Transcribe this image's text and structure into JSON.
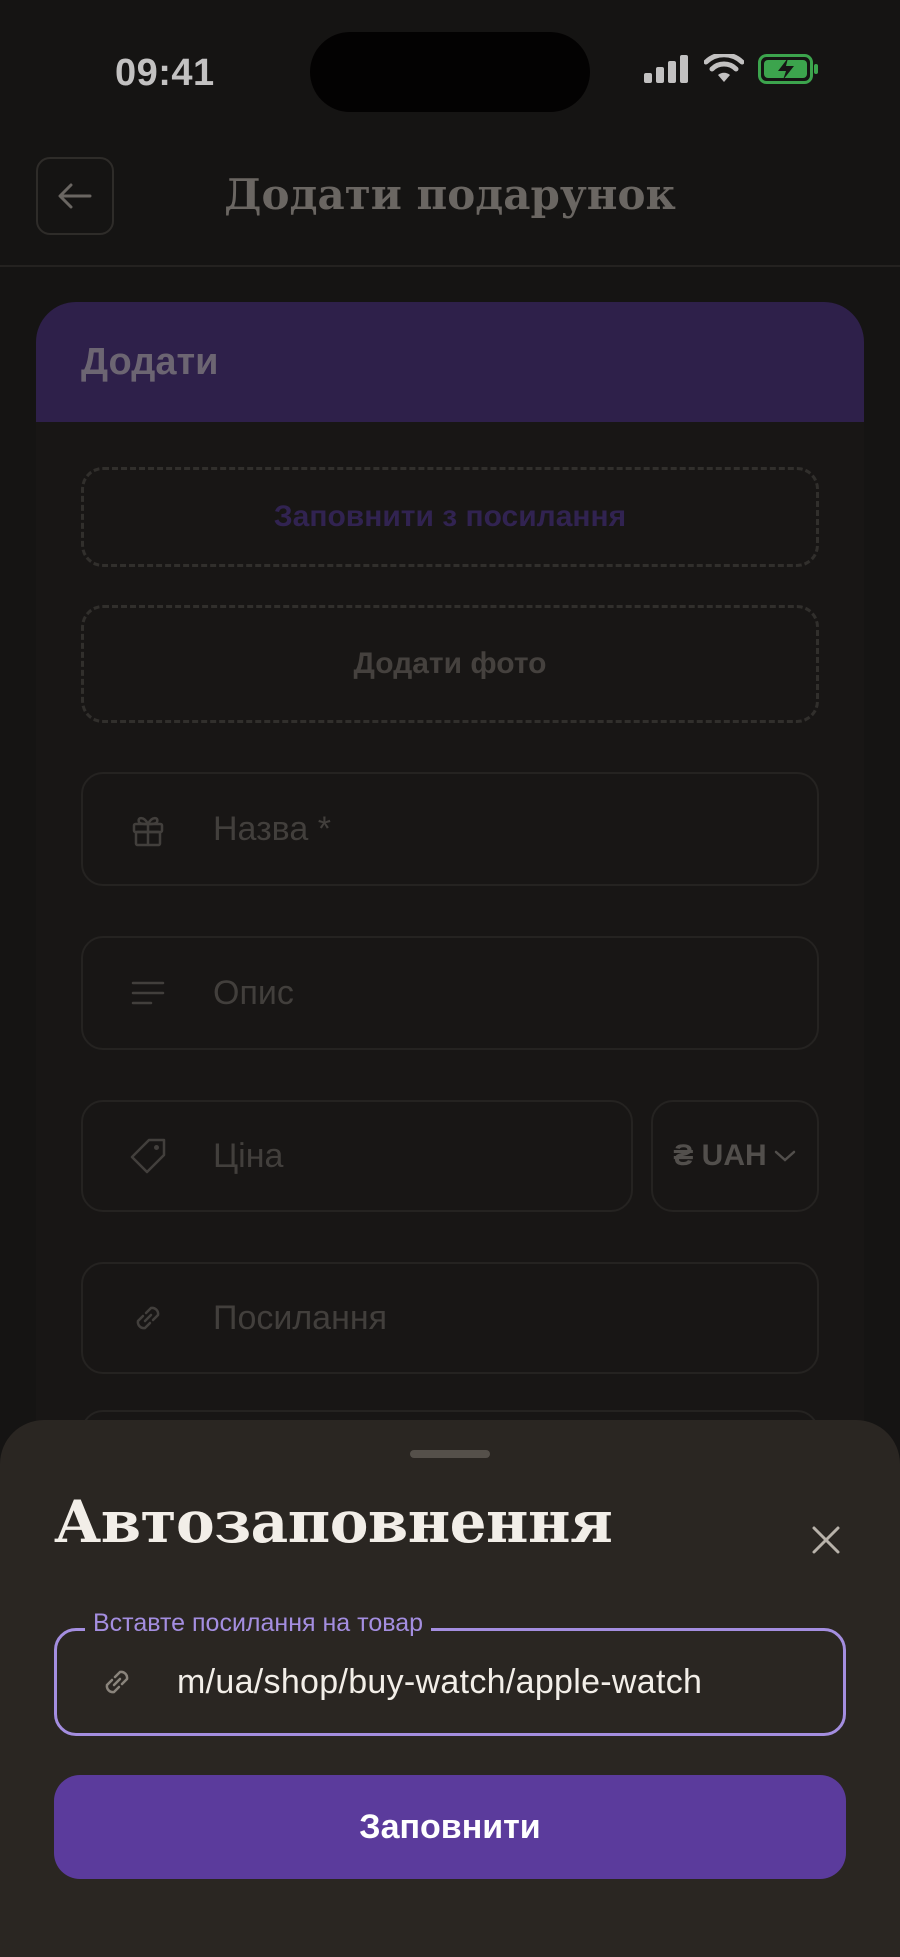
{
  "status_bar": {
    "time": "09:41"
  },
  "header": {
    "title": "Додати подарунок"
  },
  "card": {
    "heading": "Додати",
    "fill_from_link": "Заповнити з посилання",
    "add_photo": "Додати фото",
    "fields": {
      "name_placeholder": "Назва *",
      "description_placeholder": "Опис",
      "price_placeholder": "Ціна",
      "currency": "₴ UAH",
      "link_placeholder": "Посилання"
    }
  },
  "sheet": {
    "title": "Автозаповнення",
    "url_label": "Вставте посилання на товар",
    "url_value": "m/ua/shop/buy-watch/apple-watch",
    "submit": "Заповнити"
  },
  "colors": {
    "accent": "#5b3b9c",
    "accent_light": "#a48ee0",
    "battery": "#4cd964"
  }
}
